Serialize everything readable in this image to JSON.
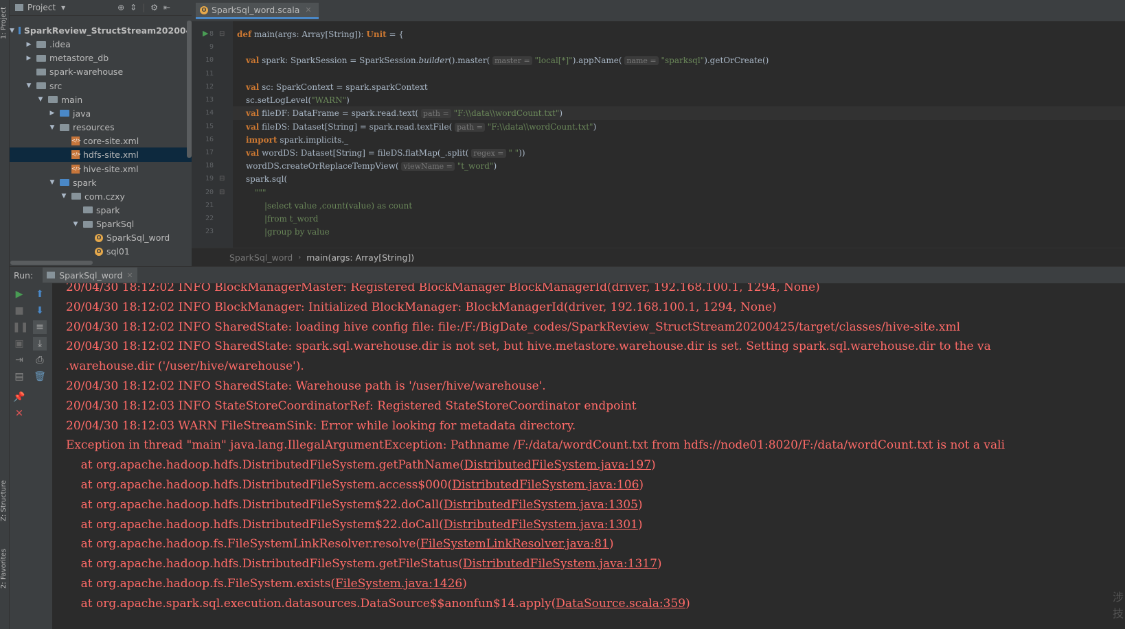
{
  "left_strip": {
    "project_tab": "1: Project",
    "structure_tab": "Z: Structure",
    "favorites_tab": "2: Favorites"
  },
  "project": {
    "header_label": "Project",
    "tree": [
      {
        "label": "SparkReview_StructStream20200425",
        "level": 0,
        "kind": "module",
        "expanded": true
      },
      {
        "label": ".idea",
        "level": 1,
        "kind": "folder",
        "expanded": false
      },
      {
        "label": "metastore_db",
        "level": 1,
        "kind": "folder",
        "expanded": false
      },
      {
        "label": "spark-warehouse",
        "level": 1,
        "kind": "folder",
        "leaf": true
      },
      {
        "label": "src",
        "level": 1,
        "kind": "folder",
        "expanded": true
      },
      {
        "label": "main",
        "level": 2,
        "kind": "folder",
        "expanded": true
      },
      {
        "label": "java",
        "level": 3,
        "kind": "folder-blue",
        "expanded": false
      },
      {
        "label": "resources",
        "level": 3,
        "kind": "folder-res",
        "expanded": true
      },
      {
        "label": "core-site.xml",
        "level": 4,
        "kind": "xml"
      },
      {
        "label": "hdfs-site.xml",
        "level": 4,
        "kind": "xml",
        "selected": true
      },
      {
        "label": "hive-site.xml",
        "level": 4,
        "kind": "xml"
      },
      {
        "label": "spark",
        "level": 3,
        "kind": "folder-blue",
        "expanded": true
      },
      {
        "label": "com.czxy",
        "level": 4,
        "kind": "folder",
        "expanded": true
      },
      {
        "label": "spark",
        "level": 5,
        "kind": "folder",
        "leaf": true
      },
      {
        "label": "SparkSql",
        "level": 5,
        "kind": "folder",
        "expanded": true
      },
      {
        "label": "SparkSql_word",
        "level": 6,
        "kind": "scala"
      },
      {
        "label": "sql01",
        "level": 6,
        "kind": "scala"
      }
    ]
  },
  "editor": {
    "tab_label": "SparkSql_word.scala",
    "line_numbers": [
      "8",
      "9",
      "10",
      "11",
      "12",
      "13",
      "14",
      "15",
      "16",
      "17",
      "18",
      "19",
      "20",
      "21",
      "22",
      "23"
    ],
    "breadcrumb": {
      "file": "SparkSql_word",
      "method": "main(args: Array[String])"
    }
  },
  "run": {
    "label": "Run:",
    "tab_label": "SparkSql_word",
    "console": [
      {
        "text": "20/04/30 18:12:02 INFO BlockManagerMaster: Registered BlockManager BlockManagerId(driver, 192.168.100.1, 1294, None)"
      },
      {
        "text": "20/04/30 18:12:02 INFO BlockManager: Initialized BlockManager: BlockManagerId(driver, 192.168.100.1, 1294, None)"
      },
      {
        "text": "20/04/30 18:12:02 INFO SharedState: loading hive config file: file:/F:/BigDate_codes/SparkReview_StructStream20200425/target/classes/hive-site.xml"
      },
      {
        "text": "20/04/30 18:12:02 INFO SharedState: spark.sql.warehouse.dir is not set, but hive.metastore.warehouse.dir is set. Setting spark.sql.warehouse.dir to the va"
      },
      {
        "text": " .warehouse.dir ('/user/hive/warehouse')."
      },
      {
        "text": "20/04/30 18:12:02 INFO SharedState: Warehouse path is '/user/hive/warehouse'."
      },
      {
        "text": "20/04/30 18:12:03 INFO StateStoreCoordinatorRef: Registered StateStoreCoordinator endpoint"
      },
      {
        "text": "20/04/30 18:12:03 WARN FileStreamSink: Error while looking for metadata directory."
      },
      {
        "text": "Exception in thread \"main\" java.lang.IllegalArgumentException: Pathname /F:/data/wordCount.txt from hdfs://node01:8020/F:/data/wordCount.txt is not a vali"
      }
    ],
    "stack": [
      {
        "prefix": "    at org.apache.hadoop.hdfs.DistributedFileSystem.getPathName(",
        "link": "DistributedFileSystem.java:197",
        "suffix": ")"
      },
      {
        "prefix": "    at org.apache.hadoop.hdfs.DistributedFileSystem.access$000(",
        "link": "DistributedFileSystem.java:106",
        "suffix": ")"
      },
      {
        "prefix": "    at org.apache.hadoop.hdfs.DistributedFileSystem$22.doCall(",
        "link": "DistributedFileSystem.java:1305",
        "suffix": ")"
      },
      {
        "prefix": "    at org.apache.hadoop.hdfs.DistributedFileSystem$22.doCall(",
        "link": "DistributedFileSystem.java:1301",
        "suffix": ")"
      },
      {
        "prefix": "    at org.apache.hadoop.fs.FileSystemLinkResolver.resolve(",
        "link": "FileSystemLinkResolver.java:81",
        "suffix": ")"
      },
      {
        "prefix": "    at org.apache.hadoop.hdfs.DistributedFileSystem.getFileStatus(",
        "link": "DistributedFileSystem.java:1317",
        "suffix": ")"
      },
      {
        "prefix": "    at org.apache.hadoop.fs.FileSystem.exists(",
        "link": "FileSystem.java:1426",
        "suffix": ")"
      },
      {
        "prefix": "    at org.apache.spark.sql.execution.datasources.DataSource$$anonfun$14.apply(",
        "link": "DataSource.scala:359",
        "suffix": ")"
      }
    ]
  },
  "colors": {
    "error_text": "#ff6b68",
    "keyword": "#cc7832",
    "string": "#6a8759",
    "selection": "#0d293e"
  }
}
